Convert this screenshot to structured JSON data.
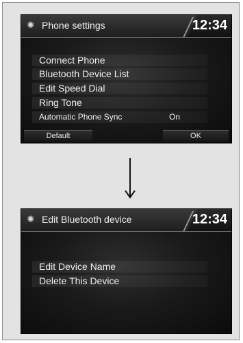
{
  "screen1": {
    "title": "Phone settings",
    "clock": "12:34",
    "menu": [
      {
        "label": "Connect Phone"
      },
      {
        "label": "Bluetooth Device List"
      },
      {
        "label": "Edit Speed Dial"
      },
      {
        "label": "Ring Tone"
      },
      {
        "label": "Automatic Phone Sync",
        "value": "On"
      }
    ],
    "buttons": {
      "default_label": "Default",
      "ok_label": "OK"
    }
  },
  "screen2": {
    "title": "Edit Bluetooth device",
    "clock": "12:34",
    "menu": [
      {
        "label": "Edit Device Name"
      },
      {
        "label": "Delete This Device"
      }
    ]
  },
  "icons": {
    "title_icon": "gear-icon",
    "transition": "arrow-down-icon"
  },
  "colors": {
    "screen_background": "#1a1a1a",
    "text": "#f0f0f0",
    "frame_background": "#e3e3e3"
  }
}
